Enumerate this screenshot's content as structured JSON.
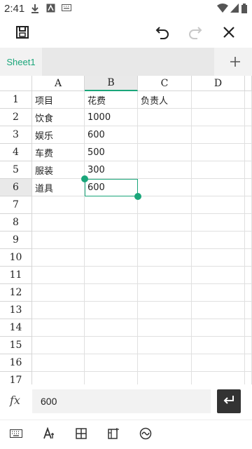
{
  "status": {
    "time": "2:41"
  },
  "sheet_tab": {
    "label": "Sheet1"
  },
  "columns": [
    "A",
    "B",
    "C",
    "D"
  ],
  "rows": [
    "1",
    "2",
    "3",
    "4",
    "5",
    "6",
    "7",
    "8",
    "9",
    "10",
    "11",
    "12",
    "13",
    "14",
    "15",
    "16",
    "17"
  ],
  "cells": [
    [
      "项目",
      "花费",
      "负责人",
      ""
    ],
    [
      "饮食",
      "1000",
      "",
      ""
    ],
    [
      "娱乐",
      "600",
      "",
      ""
    ],
    [
      "车费",
      "500",
      "",
      ""
    ],
    [
      "服装",
      "300",
      "",
      ""
    ],
    [
      "道具",
      "600",
      "",
      ""
    ]
  ],
  "selected": {
    "column": "B",
    "row": "6"
  },
  "formula": {
    "value": "600"
  },
  "colors": {
    "accent": "#1aa67a"
  }
}
